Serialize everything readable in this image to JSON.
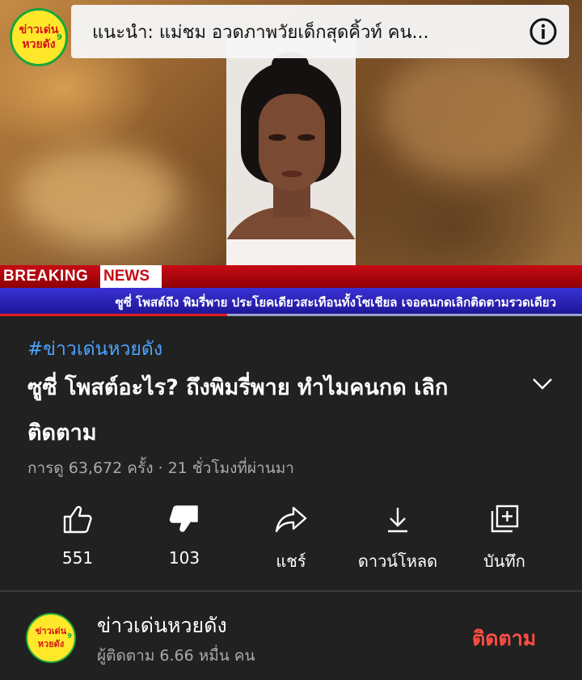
{
  "video": {
    "logo_line1": "ข่าวเด่น",
    "logo_line2": "หวยดัง",
    "logo_number": "9",
    "suggestion_text": "แนะนำ: แม่ชม อวดภาพวัยเด็กสุดคิ้วท์ คน...",
    "breaking_word": "BREAKING",
    "news_word": "NEWS",
    "ticker_text": "ซูซี่ โพสต์ถึง พิมรี่พาย ประโยคเดียวสะเทือนทั้งโซเชียล เจอคนกดเลิกติดตามรวดเดียว",
    "progress_fraction": 0.39,
    "colors": {
      "progress": "#e51d1d",
      "breaking_red": "#c80b14",
      "ticker_blue": "#2f28c4"
    }
  },
  "details": {
    "hashtag": "#ข่าวเด่นหวยดัง",
    "title": "ซูซี่ โพสต์อะไร? ถึงพิมรี่พาย  ทำไมคนกด เลิกติดตาม",
    "meta": "การดู 63,672 ครั้ง · 21 ชั่วโมงที่ผ่านมา"
  },
  "actions": [
    {
      "icon": "thumbs-up-icon",
      "label": "551"
    },
    {
      "icon": "thumbs-down-icon",
      "label": "103"
    },
    {
      "icon": "share-icon",
      "label": "แชร์"
    },
    {
      "icon": "download-icon",
      "label": "ดาวน์โหลด"
    },
    {
      "icon": "save-to-playlist-icon",
      "label": "บันทึก"
    }
  ],
  "channel": {
    "logo_line1": "ข่าวเด่น",
    "logo_line2": "หวยดัง",
    "logo_number": "9",
    "name": "ข่าวเด่นหวยดัง",
    "subscribers": "ผู้ติดตาม 6.66 หมื่น คน",
    "subscribe_label": "ติดตาม",
    "subscribe_color": "#ff4e45"
  }
}
